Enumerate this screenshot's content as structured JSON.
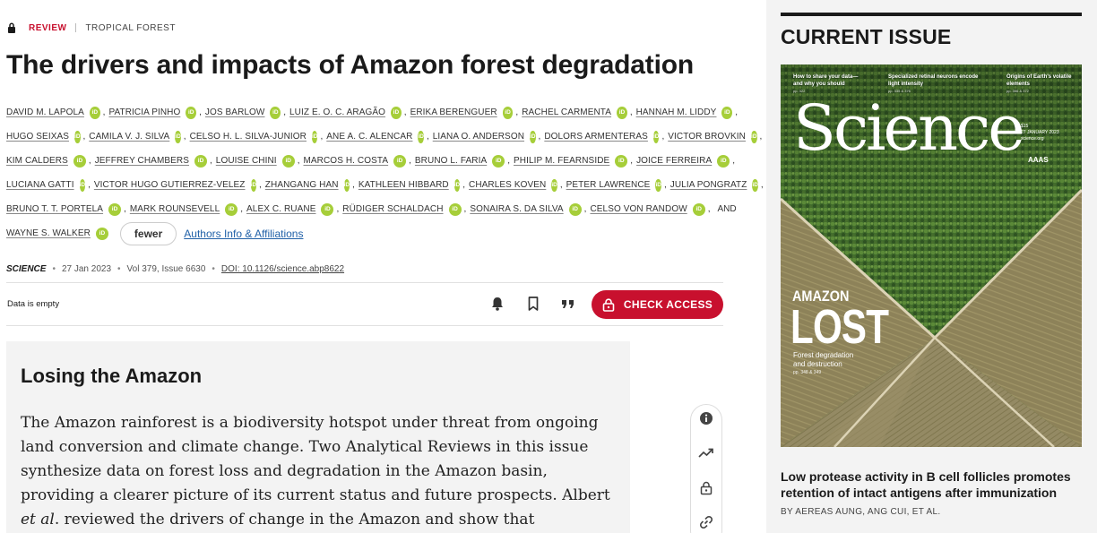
{
  "breadcrumb": {
    "section": "REVIEW",
    "topic": "TROPICAL FOREST"
  },
  "article": {
    "title": "The drivers and impacts of Amazon forest degradation",
    "authors_rows": [
      [
        "DAVID M. LAPOLA",
        "PATRICIA PINHO",
        "JOS BARLOW",
        "LUIZ E. O. C. ARAGÃO",
        "ERIKA BERENGUER",
        "RACHEL CARMENTA",
        "HANNAH M. LIDDY"
      ],
      [
        "HUGO SEIXAS",
        "CAMILA V. J. SILVA",
        "CELSO H. L. SILVA-JUNIOR",
        "ANE A. C. ALENCAR",
        "LIANA O. ANDERSON",
        "DOLORS ARMENTERAS",
        "VICTOR BROVKIN"
      ],
      [
        "KIM CALDERS",
        "JEFFREY CHAMBERS",
        "LOUISE CHINI",
        "MARCOS H. COSTA",
        "BRUNO L. FARIA",
        "PHILIP M. FEARNSIDE",
        "JOICE FERREIRA"
      ],
      [
        "LUCIANA GATTI",
        "VICTOR HUGO GUTIERREZ-VELEZ",
        "ZHANGANG HAN",
        "KATHLEEN HIBBARD",
        "CHARLES KOVEN",
        "PETER LAWRENCE",
        "JULIA PONGRATZ"
      ],
      [
        "BRUNO T. T. PORTELA",
        "MARK ROUNSEVELL",
        "ALEX C. RUANE",
        "RÜDIGER SCHALDACH",
        "SONAIRA S. DA SILVA",
        "CELSO VON RANDOW"
      ]
    ],
    "last_author": "WAYNE S. WALKER",
    "and_word": "AND",
    "orcid_label": "iD",
    "fewer_label": "fewer",
    "affiliations_link": "Authors Info & Affiliations",
    "journal": "SCIENCE",
    "date": "27 Jan 2023",
    "volume_issue": "Vol 379, Issue 6630",
    "doi": "DOI: 10.1126/science.abp8622"
  },
  "toolbar": {
    "data_status": "Data is empty",
    "check_access_label": "CHECK ACCESS",
    "icons": [
      "bell-icon",
      "bookmark-icon",
      "quote-icon",
      "lock-icon"
    ]
  },
  "abstract": {
    "heading": "Losing the Amazon",
    "text_before_italic": "The Amazon rainforest is a biodiversity hotspot under threat from ongoing land conversion and climate change. Two Analytical Reviews in this issue synthesize data on forest loss and degradation in the Amazon basin, providing a clearer pic­ture of its current status and future prospects. Albert ",
    "text_italic": "et al",
    "text_after_italic": ". reviewed the drivers of change in the Amazon and show that anthropogenic changes are occurring much"
  },
  "side_tools": [
    "info-icon",
    "trending-icon",
    "lock-icon",
    "link-icon"
  ],
  "sidebar": {
    "heading": "CURRENT ISSUE",
    "cover": {
      "teaser1_title": "How to share your data—",
      "teaser1_title2": "and why you should",
      "teaser1_pp": "pp. 322",
      "teaser2_title": "Specialized retinal neurons encode",
      "teaser2_title2": "light intensity",
      "teaser2_pp": "pp. 335 & 376",
      "teaser3_title": "Origins of Earth's volatile",
      "teaser3_title2": "elements",
      "teaser3_pp": "pp. 356 & 372",
      "masthead": "Science",
      "date_line1": "$15",
      "date_line2": "27 JANUARY 2023",
      "date_line3": "science.org",
      "publisher": "AAAS",
      "kicker": "AMAZON",
      "headline": "LOST",
      "subhead1": "Forest degradation",
      "subhead2": "and destruction",
      "cover_pages": "pp. 348 & 349"
    },
    "article_title": "Low protease activity in B cell follicles promotes re­tention of intact antigens after immunization",
    "byline": "BY AEREAS AUNG, ANG CUI, ET AL."
  }
}
